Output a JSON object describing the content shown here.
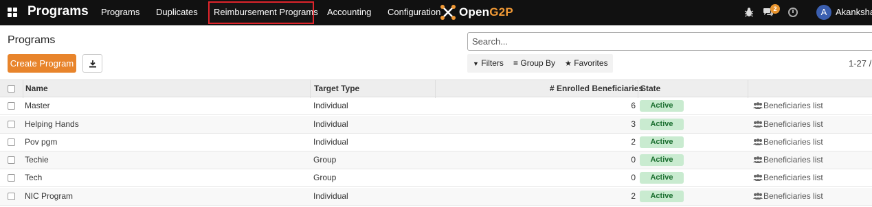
{
  "topbar": {
    "brand": "Programs",
    "menu": [
      {
        "label": "Programs"
      },
      {
        "label": "Duplicates"
      },
      {
        "label": "Reimbursement Programs"
      },
      {
        "label": "Accounting"
      },
      {
        "label": "Configuration"
      }
    ],
    "logo": {
      "text_open": "Open",
      "text_g2p": "G2P"
    },
    "chat_badge": "2",
    "avatar_letter": "A",
    "username": "Akanksha"
  },
  "page": {
    "title": "Programs",
    "create_label": "Create Program"
  },
  "search": {
    "placeholder": "Search..."
  },
  "filters": {
    "filters_label": "Filters",
    "groupby_label": "Group By",
    "favorites_label": "Favorites"
  },
  "pager": "1-27 /",
  "table": {
    "headers": {
      "name": "Name",
      "target_type": "Target Type",
      "enrolled": "# Enrolled Beneficiaries",
      "state": "State"
    },
    "rows": [
      {
        "name": "Master",
        "target_type": "Individual",
        "enrolled": "6",
        "state": "Active",
        "link": "Beneficiaries list"
      },
      {
        "name": "Helping Hands",
        "target_type": "Individual",
        "enrolled": "3",
        "state": "Active",
        "link": "Beneficiaries list"
      },
      {
        "name": "Pov pgm",
        "target_type": "Individual",
        "enrolled": "2",
        "state": "Active",
        "link": "Beneficiaries list"
      },
      {
        "name": "Techie",
        "target_type": "Group",
        "enrolled": "0",
        "state": "Active",
        "link": "Beneficiaries list"
      },
      {
        "name": "Tech",
        "target_type": "Group",
        "enrolled": "0",
        "state": "Active",
        "link": "Beneficiaries list"
      },
      {
        "name": "NIC Program",
        "target_type": "Individual",
        "enrolled": "2",
        "state": "Active",
        "link": "Beneficiaries list"
      }
    ]
  },
  "colors": {
    "topbar": "#111111",
    "accent": "#e8842b",
    "highlight_border": "#e0242b",
    "active_badge_bg": "#c9ebd0",
    "active_badge_text": "#1a6e2f"
  }
}
